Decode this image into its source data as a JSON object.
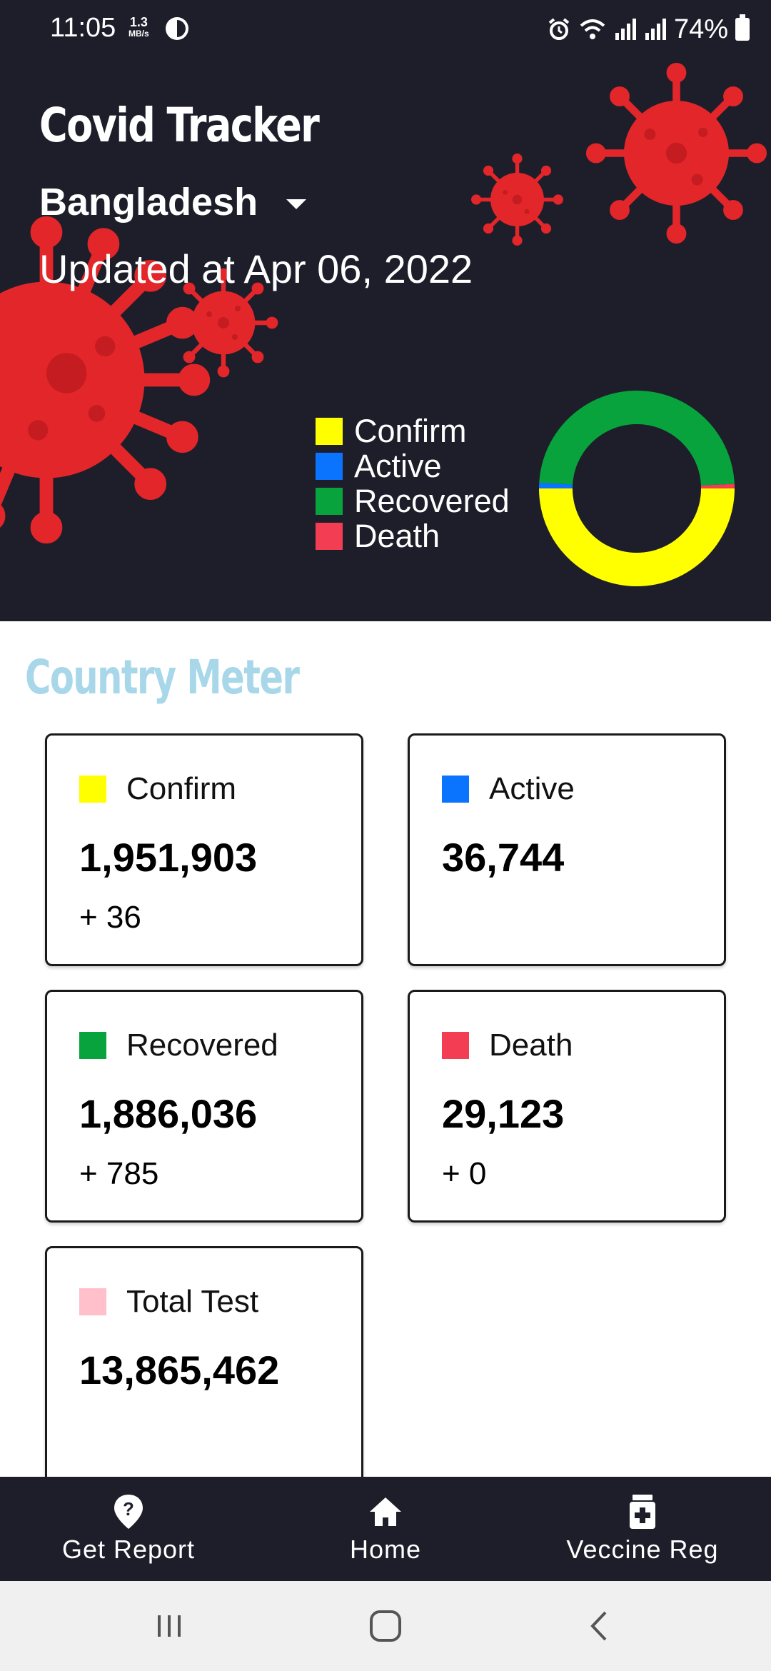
{
  "status_bar": {
    "time": "11:05",
    "speed_value": "1.3",
    "speed_unit": "MB/s",
    "battery": "74%"
  },
  "header": {
    "title": "Covid Tracker",
    "country": "Bangladesh",
    "updated": "Updated at Apr 06, 2022"
  },
  "legend": [
    {
      "label": "Confirm",
      "color": "#ffff00"
    },
    {
      "label": "Active",
      "color": "#0a74ff"
    },
    {
      "label": "Recovered",
      "color": "#08a33c"
    },
    {
      "label": "Death",
      "color": "#f23d52"
    }
  ],
  "chart_data": {
    "type": "pie",
    "variant": "donut",
    "categories": [
      "Confirm",
      "Active",
      "Recovered",
      "Death"
    ],
    "values": [
      1951903,
      36744,
      1886036,
      29123
    ],
    "colors": [
      "#ffff00",
      "#0a74ff",
      "#08a33c",
      "#f23d52"
    ]
  },
  "section": {
    "title": "Country Meter"
  },
  "cards": [
    {
      "label": "Confirm",
      "value": "1,951,903",
      "delta": "+ 36",
      "color": "#ffff00"
    },
    {
      "label": "Active",
      "value": "36,744",
      "delta": "",
      "color": "#0a74ff"
    },
    {
      "label": "Recovered",
      "value": "1,886,036",
      "delta": "+ 785",
      "color": "#08a33c"
    },
    {
      "label": "Death",
      "value": "29,123",
      "delta": "+ 0",
      "color": "#f23d52"
    },
    {
      "label": "Total Test",
      "value": "13,865,462",
      "delta": "",
      "color": "#ffc0cb"
    }
  ],
  "bottom_nav": [
    {
      "label": "Get Report",
      "icon": "location-question-icon"
    },
    {
      "label": "Home",
      "icon": "home-icon"
    },
    {
      "label": "Veccine Reg",
      "icon": "medicine-bottle-icon"
    }
  ],
  "colors": {
    "header_bg": "#1e1e2b",
    "virus_red": "#e3262a",
    "section_title": "#a7d7e9"
  }
}
